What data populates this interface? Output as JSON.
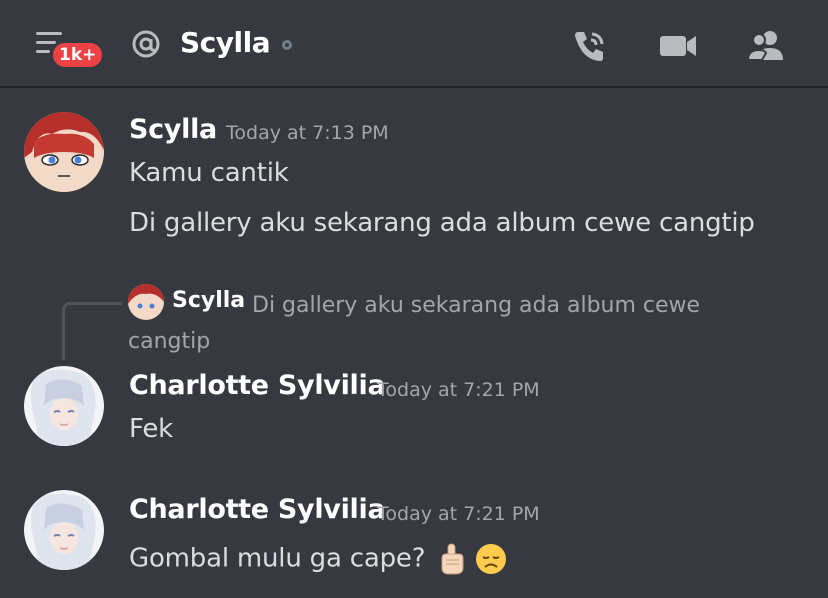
{
  "header": {
    "unread_badge": "1k+",
    "channel_name": "Scylla",
    "icons": [
      "menu-icon",
      "at-icon",
      "call-icon",
      "video-icon",
      "members-icon"
    ]
  },
  "messages": [
    {
      "username": "Scylla",
      "timestamp": "Today at 7:13 PM",
      "lines": [
        "Kamu cantik",
        "Di gallery aku sekarang ada album cewe cangtip"
      ]
    },
    {
      "reply": {
        "username": "Scylla",
        "text": "Di gallery aku sekarang ada album cewe cangtip"
      },
      "username": "Charlotte Sylvilia",
      "timestamp": "Today at 7:21 PM",
      "lines": [
        "Fek"
      ]
    },
    {
      "username": "Charlotte Sylvilia",
      "timestamp": "Today at 7:21 PM",
      "lines": [
        "Gombal mulu ga cape?"
      ],
      "emojis": [
        "pointing-up-emoji",
        "disappointed-face-emoji"
      ]
    }
  ],
  "colors": {
    "background": "#36393f",
    "badge": "#ed4245",
    "username": "#ffffff",
    "timestamp": "#a3a6aa"
  }
}
